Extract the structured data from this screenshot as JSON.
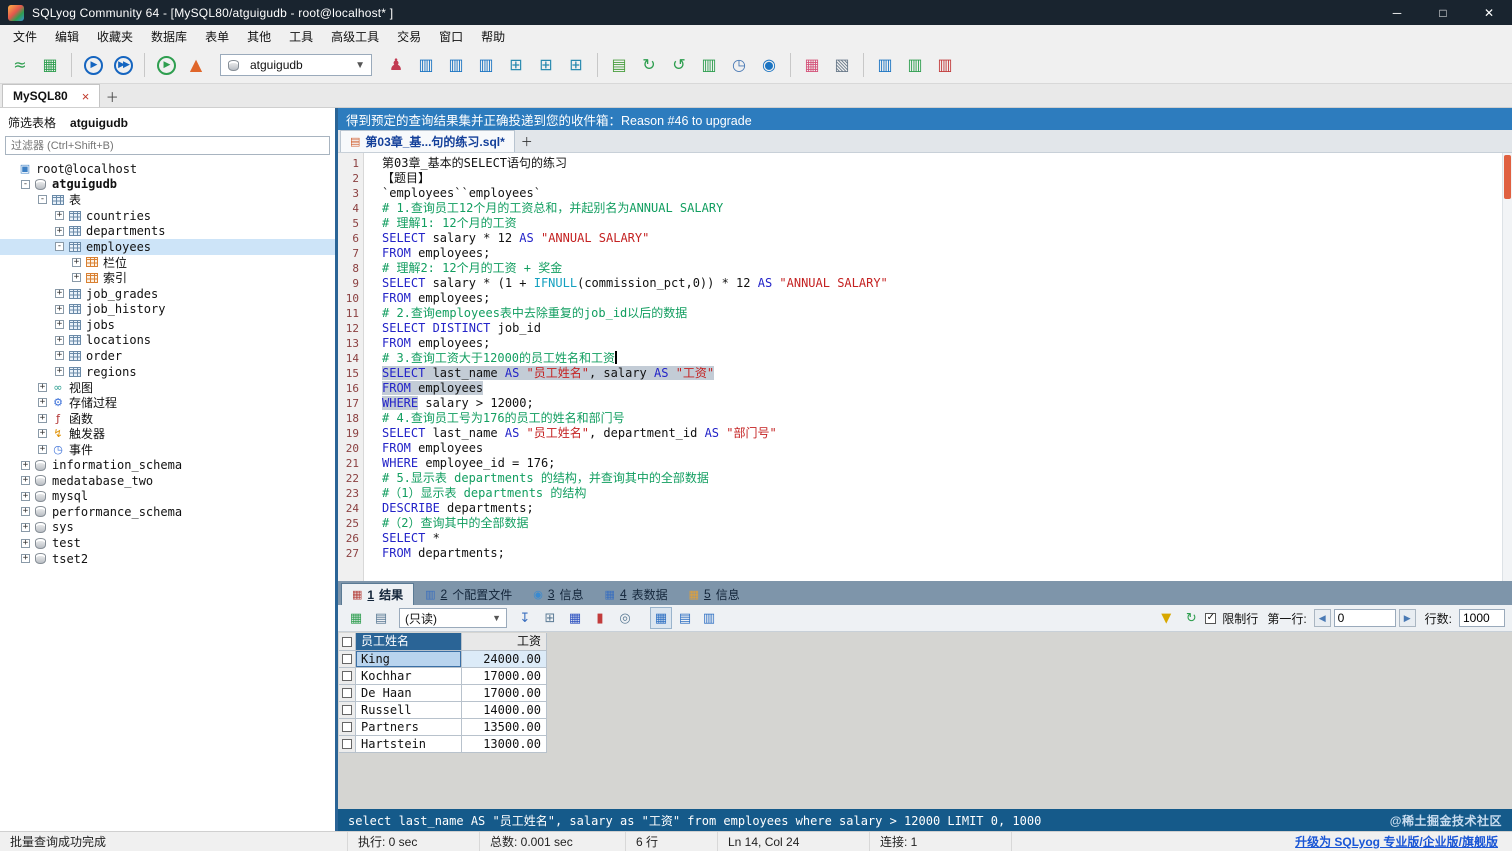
{
  "window": {
    "title": "SQLyog Community 64 - [MySQL80/atguigudb - root@localhost* ]"
  },
  "icons": {
    "minimize": "─",
    "maximize": "□",
    "close": "✕",
    "tab_close": "×",
    "plus": "＋",
    "dropdown": "▼",
    "prev": "◀",
    "next": "▶",
    "check": "✓",
    "funnel": "▼",
    "refresh": "↻"
  },
  "menu": {
    "items": [
      "文件",
      "编辑",
      "收藏夹",
      "数据库",
      "表单",
      "其他",
      "工具",
      "高级工具",
      "交易",
      "窗口",
      "帮助"
    ]
  },
  "toolbar": {
    "db_selector": "atguigudb",
    "buttons_left": [
      {
        "name": "connect-icon",
        "g": "≈",
        "c": "#2e9e4f"
      },
      {
        "name": "new-table-icon",
        "g": "▦",
        "c": "#2e9e4f"
      },
      {
        "sep": true
      },
      {
        "name": "execute-query-icon",
        "g": "▶",
        "c": "#1565c0",
        "circ": true
      },
      {
        "name": "execute-all-icon",
        "g": "▶▶",
        "c": "#1565c0",
        "circ": true
      },
      {
        "sep": true
      },
      {
        "name": "execute-current-icon",
        "g": "▶",
        "c": "#2e9e4f",
        "circ": true
      },
      {
        "name": "query-profiler-icon",
        "g": "▲",
        "c": "#e0662a"
      }
    ],
    "buttons_right": [
      {
        "name": "user-manager-icon",
        "g": "♟",
        "c": "#c23b52"
      },
      {
        "name": "open-database-icon",
        "g": "▥",
        "c": "#1b74c2"
      },
      {
        "name": "refresh-object-browser-icon",
        "g": "▥",
        "c": "#1b74c2"
      },
      {
        "name": "database-sync-icon",
        "g": "▥",
        "c": "#1b74c2"
      },
      {
        "name": "table-grid-icon",
        "g": "⊞",
        "c": "#2a8ab0"
      },
      {
        "name": "insert-update-icon",
        "g": "⊞",
        "c": "#2a8ab0"
      },
      {
        "name": "table-data-icon",
        "g": "⊞",
        "c": "#2a8ab0"
      },
      {
        "sep": true
      },
      {
        "name": "new-editor-icon",
        "g": "▤",
        "c": "#4a9e3f"
      },
      {
        "name": "refresh-icon",
        "g": "↻",
        "c": "#2e9e4f"
      },
      {
        "name": "reconnect-icon",
        "g": "↺",
        "c": "#2e9e4f"
      },
      {
        "name": "backup-database-icon",
        "g": "▥",
        "c": "#2e9e4f"
      },
      {
        "name": "history-icon",
        "g": "◷",
        "c": "#4a7ab5"
      },
      {
        "name": "scheduler-icon",
        "g": "◉",
        "c": "#1b74c2"
      },
      {
        "sep": true
      },
      {
        "name": "copy-table-icon",
        "g": "▦",
        "c": "#d4537a"
      },
      {
        "name": "schema-designer-icon",
        "g": "▧",
        "c": "#6a7a8a"
      },
      {
        "sep": true
      },
      {
        "name": "import-data-icon",
        "g": "▥",
        "c": "#1b74c2"
      },
      {
        "name": "export-data-icon",
        "g": "▥",
        "c": "#2e9e4f"
      },
      {
        "name": "notifications-icon",
        "g": "▥",
        "c": "#c23b3b"
      }
    ]
  },
  "tabs": {
    "connection_tab": "MySQL80"
  },
  "sidebar": {
    "header_label": "筛选表格",
    "header_db": "atguigudb",
    "filter_placeholder": "过滤器 (Ctrl+Shift+B)",
    "icon_map": {
      "connection": {
        "g": "▣",
        "c": "#3b7fc4"
      },
      "database": {
        "cls": "cyl"
      },
      "tables-folder": {
        "cls": "grid-b"
      },
      "table": {
        "cls": "grid-b"
      },
      "columns": {
        "cls": "grid-o"
      },
      "index": {
        "cls": "grid-o"
      },
      "views-folder": {
        "g": "∞",
        "c": "#2a9d8f"
      },
      "procedures-folder": {
        "g": "⚙",
        "c": "#3a6fd8"
      },
      "functions-folder": {
        "g": "ƒ",
        "c": "#b03030"
      },
      "triggers-folder": {
        "g": "↯",
        "c": "#e09000"
      },
      "events-folder": {
        "g": "◷",
        "c": "#3a6fd8"
      }
    },
    "tree": [
      {
        "label": "root@localhost",
        "lvl": 0,
        "icon": "connection",
        "exp": ""
      },
      {
        "label": "atguigudb",
        "lvl": 1,
        "icon": "database",
        "exp": "-",
        "bold": true
      },
      {
        "label": "表",
        "lvl": 2,
        "icon": "tables-folder",
        "exp": "-"
      },
      {
        "label": "countries",
        "lvl": 3,
        "icon": "table",
        "exp": "+"
      },
      {
        "label": "departments",
        "lvl": 3,
        "icon": "table",
        "exp": "+"
      },
      {
        "label": "employees",
        "lvl": 3,
        "icon": "table",
        "exp": "-",
        "sel": true
      },
      {
        "label": "栏位",
        "lvl": 4,
        "icon": "columns",
        "exp": "+"
      },
      {
        "label": "索引",
        "lvl": 4,
        "icon": "index",
        "exp": "+"
      },
      {
        "label": "job_grades",
        "lvl": 3,
        "icon": "table",
        "exp": "+"
      },
      {
        "label": "job_history",
        "lvl": 3,
        "icon": "table",
        "exp": "+"
      },
      {
        "label": "jobs",
        "lvl": 3,
        "icon": "table",
        "exp": "+"
      },
      {
        "label": "locations",
        "lvl": 3,
        "icon": "table",
        "exp": "+"
      },
      {
        "label": "order",
        "lvl": 3,
        "icon": "table",
        "exp": "+"
      },
      {
        "label": "regions",
        "lvl": 3,
        "icon": "table",
        "exp": "+"
      },
      {
        "label": "视图",
        "lvl": 2,
        "icon": "views-folder",
        "exp": "+"
      },
      {
        "label": "存储过程",
        "lvl": 2,
        "icon": "procedures-folder",
        "exp": "+"
      },
      {
        "label": "函数",
        "lvl": 2,
        "icon": "functions-folder",
        "exp": "+"
      },
      {
        "label": "触发器",
        "lvl": 2,
        "icon": "triggers-folder",
        "exp": "+"
      },
      {
        "label": "事件",
        "lvl": 2,
        "icon": "events-folder",
        "exp": "+"
      },
      {
        "label": "information_schema",
        "lvl": 1,
        "icon": "database",
        "exp": "+"
      },
      {
        "label": "medatabase_two",
        "lvl": 1,
        "icon": "database",
        "exp": "+"
      },
      {
        "label": "mysql",
        "lvl": 1,
        "icon": "database",
        "exp": "+"
      },
      {
        "label": "performance_schema",
        "lvl": 1,
        "icon": "database",
        "exp": "+"
      },
      {
        "label": "sys",
        "lvl": 1,
        "icon": "database",
        "exp": "+"
      },
      {
        "label": "test",
        "lvl": 1,
        "icon": "database",
        "exp": "+"
      },
      {
        "label": "tset2",
        "lvl": 1,
        "icon": "database",
        "exp": "+"
      }
    ]
  },
  "banner": {
    "text": "得到预定的查询结果集并正确投递到您的收件箱：Reason #46 to upgrade"
  },
  "editor": {
    "tab_label": "第03章_基...句的练习.sql*",
    "cursor_line": 14,
    "lines": [
      [
        [
          "p",
          "第03章_基本的SELECT语句的练习"
        ]
      ],
      [
        [
          "p",
          "【题目】"
        ]
      ],
      [
        [
          "p",
          "`employees``employees`"
        ]
      ],
      [
        [
          "c",
          "# 1.查询员工12个月的工资总和，并起别名为ANNUAL SALARY"
        ]
      ],
      [
        [
          "c",
          "# 理解1: 12个月的工资"
        ]
      ],
      [
        [
          "k",
          "SELECT"
        ],
        [
          "p",
          " salary * 12 "
        ],
        [
          "k",
          "AS"
        ],
        [
          "p",
          " "
        ],
        [
          "s",
          "\"ANNUAL SALARY\""
        ]
      ],
      [
        [
          "k",
          "FROM"
        ],
        [
          "p",
          " employees;"
        ]
      ],
      [
        [
          "c",
          "# 理解2: 12个月的工资 + 奖金"
        ]
      ],
      [
        [
          "k",
          "SELECT"
        ],
        [
          "p",
          " salary * (1 + "
        ],
        [
          "f",
          "IFNULL"
        ],
        [
          "p",
          "(commission_pct,0)) * 12 "
        ],
        [
          "k",
          "AS"
        ],
        [
          "p",
          " "
        ],
        [
          "s",
          "\"ANNUAL SALARY\""
        ]
      ],
      [
        [
          "k",
          "FROM"
        ],
        [
          "p",
          " employees;"
        ]
      ],
      [
        [
          "c",
          "# 2.查询employees表中去除重复的job_id以后的数据"
        ]
      ],
      [
        [
          "k",
          "SELECT"
        ],
        [
          "p",
          " "
        ],
        [
          "k",
          "DISTINCT"
        ],
        [
          "p",
          " job_id"
        ]
      ],
      [
        [
          "k",
          "FROM"
        ],
        [
          "p",
          " employees;"
        ]
      ],
      [
        [
          "c",
          "# 3.查询工资大于12000的员工姓名和工资"
        ]
      ],
      [
        [
          "k",
          "SELECT",
          1
        ],
        [
          "p",
          " last_name ",
          1
        ],
        [
          "k",
          "AS",
          1
        ],
        [
          "p",
          " ",
          1
        ],
        [
          "s",
          "\"员工姓名\"",
          1
        ],
        [
          "p",
          ", salary ",
          1
        ],
        [
          "k",
          "AS",
          1
        ],
        [
          "p",
          " ",
          1
        ],
        [
          "s",
          "\"工资\"",
          1
        ]
      ],
      [
        [
          "k",
          "FROM",
          1
        ],
        [
          "p",
          " employees",
          1
        ]
      ],
      [
        [
          "k",
          "WHERE",
          1
        ],
        [
          "p",
          " salary > 12000;"
        ]
      ],
      [
        [
          "c",
          "# 4.查询员工号为176的员工的姓名和部门号"
        ]
      ],
      [
        [
          "k",
          "SELECT"
        ],
        [
          "p",
          " last_name "
        ],
        [
          "k",
          "AS"
        ],
        [
          "p",
          " "
        ],
        [
          "s",
          "\"员工姓名\""
        ],
        [
          "p",
          ", department_id "
        ],
        [
          "k",
          "AS"
        ],
        [
          "p",
          " "
        ],
        [
          "s",
          "\"部门号\""
        ]
      ],
      [
        [
          "k",
          "FROM"
        ],
        [
          "p",
          " employees"
        ]
      ],
      [
        [
          "k",
          "WHERE"
        ],
        [
          "p",
          " employee_id = 176;"
        ]
      ],
      [
        [
          "c",
          "# 5.显示表 departments 的结构，并查询其中的全部数据"
        ]
      ],
      [
        [
          "c",
          "#（1）显示表 departments 的结构"
        ]
      ],
      [
        [
          "k",
          "DESCRIBE"
        ],
        [
          "p",
          " departments;"
        ]
      ],
      [
        [
          "c",
          "#（2）查询其中的全部数据"
        ]
      ],
      [
        [
          "k",
          "SELECT"
        ],
        [
          "p",
          " *"
        ]
      ],
      [
        [
          "k",
          "FROM"
        ],
        [
          "p",
          " departments;"
        ]
      ]
    ]
  },
  "results": {
    "tabs": [
      {
        "num": "1",
        "label": "结果",
        "icon": "▦",
        "icon_color": "#b5413c",
        "icon_name": "result-grid-icon",
        "active": true
      },
      {
        "num": "2",
        "label": "个配置文件",
        "icon": "▥",
        "icon_color": "#3a6fbf",
        "icon_name": "profile-icon"
      },
      {
        "num": "3",
        "label": "信息",
        "icon": "◉",
        "icon_color": "#3a8ad0",
        "icon_name": "info-icon"
      },
      {
        "num": "4",
        "label": "表数据",
        "icon": "▦",
        "icon_color": "#3a6fbf",
        "icon_name": "table-data-icon"
      },
      {
        "num": "5",
        "label": "信息",
        "icon": "▦",
        "icon_color": "#e0a03a",
        "icon_name": "history-icon"
      }
    ],
    "toolbar": {
      "mode": "(只读)",
      "limit_label": "限制行",
      "first_row_label": "第一行:",
      "first_row_value": "0",
      "rows_label": "行数:",
      "rows_value": "1000",
      "left1": [
        {
          "name": "insert-row-icon",
          "g": "▦",
          "c": "#2e9e4f"
        },
        {
          "name": "grid-options-icon",
          "g": "▤",
          "c": "#5a7a94"
        }
      ],
      "left2": [
        {
          "name": "export-result-icon",
          "g": "↧",
          "c": "#3a6fbf"
        },
        {
          "name": "copy-result-icon",
          "g": "⊞",
          "c": "#5a7a94"
        },
        {
          "name": "save-result-icon",
          "g": "▦",
          "c": "#2a4fbf"
        },
        {
          "name": "delete-row-icon",
          "g": "▮",
          "c": "#c23b3b"
        },
        {
          "name": "find-icon",
          "g": "◎",
          "c": "#5a7a94"
        }
      ],
      "views": [
        {
          "name": "grid-view-icon",
          "g": "▦",
          "c": "#2d6fc2",
          "active": true
        },
        {
          "name": "text-view-icon",
          "g": "▤",
          "c": "#2d6fc2"
        },
        {
          "name": "form-view-icon",
          "g": "▥",
          "c": "#2d6fc2"
        }
      ]
    },
    "grid": {
      "columns": [
        "员工姓名",
        "工资"
      ],
      "rows": [
        [
          "King",
          "24000.00"
        ],
        [
          "Kochhar",
          "17000.00"
        ],
        [
          "De Haan",
          "17000.00"
        ],
        [
          "Russell",
          "14000.00"
        ],
        [
          "Partners",
          "13500.00"
        ],
        [
          "Hartstein",
          "13000.00"
        ]
      ]
    }
  },
  "query_bar": {
    "sql": "select last_name AS \"员工姓名\", salary as \"工资\" from employees where salary > 12000 LIMIT 0, 1000",
    "watermark": "@稀土掘金技术社区"
  },
  "status_bar": {
    "message": "批量查询成功完成",
    "execution": "执行: 0 sec",
    "total": "总数: 0.001 sec",
    "rows": "6 行",
    "position": "Ln 14, Col 24",
    "connections": "连接: 1",
    "upgrade": "升级为 SQLyog 专业版/企业版/旗舰版"
  }
}
